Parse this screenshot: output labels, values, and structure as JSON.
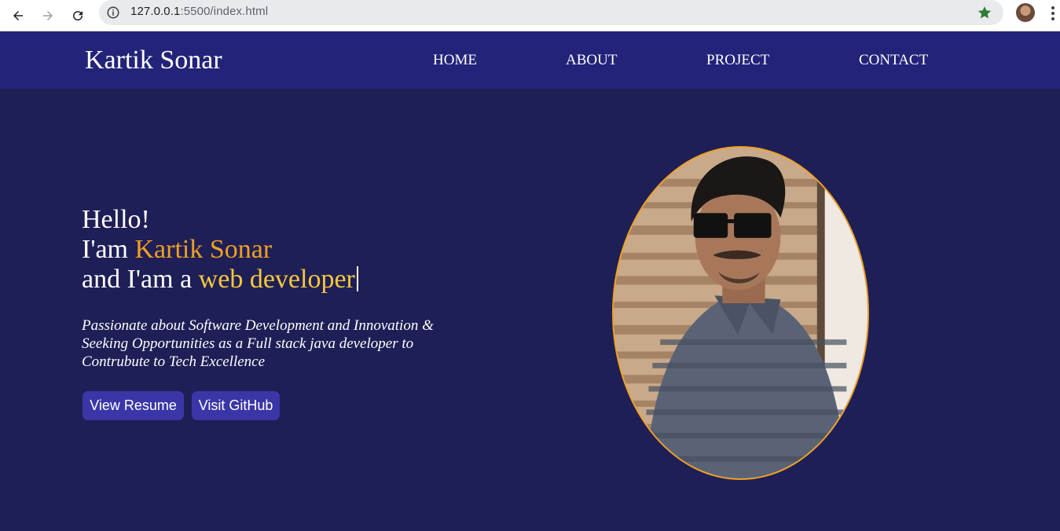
{
  "browser": {
    "url_host": "127.0.0.1",
    "url_path": ":5500/index.html",
    "icons": [
      "back-arrow-icon",
      "forward-arrow-icon",
      "reload-icon",
      "info-icon",
      "bookmark-star-icon",
      "profile-avatar",
      "more-menu-icon"
    ]
  },
  "header": {
    "brand": "Kartik Sonar",
    "nav": {
      "home": "HOME",
      "about": "ABOUT",
      "project": "PROJECT",
      "contact": "CONTACT"
    }
  },
  "hero": {
    "greeting": "Hello!",
    "intro_prefix": "I'am ",
    "name": "Kartik Sonar",
    "role_prefix": "and I'am a ",
    "role": "web developer",
    "tagline": "Passionate about Software Development and Innovation & Seeking Opportunities as a Full stack java developer to Contrubute to Tech Excellence",
    "buttons": {
      "resume": "View Resume",
      "github": "Visit GitHub"
    }
  },
  "colors": {
    "page_bg": "#1f1f57",
    "header_bg": "#23237a",
    "accent_orange": "#f0a020",
    "accent_yellow": "#f6c83a",
    "button_bg": "#3a36a8"
  }
}
